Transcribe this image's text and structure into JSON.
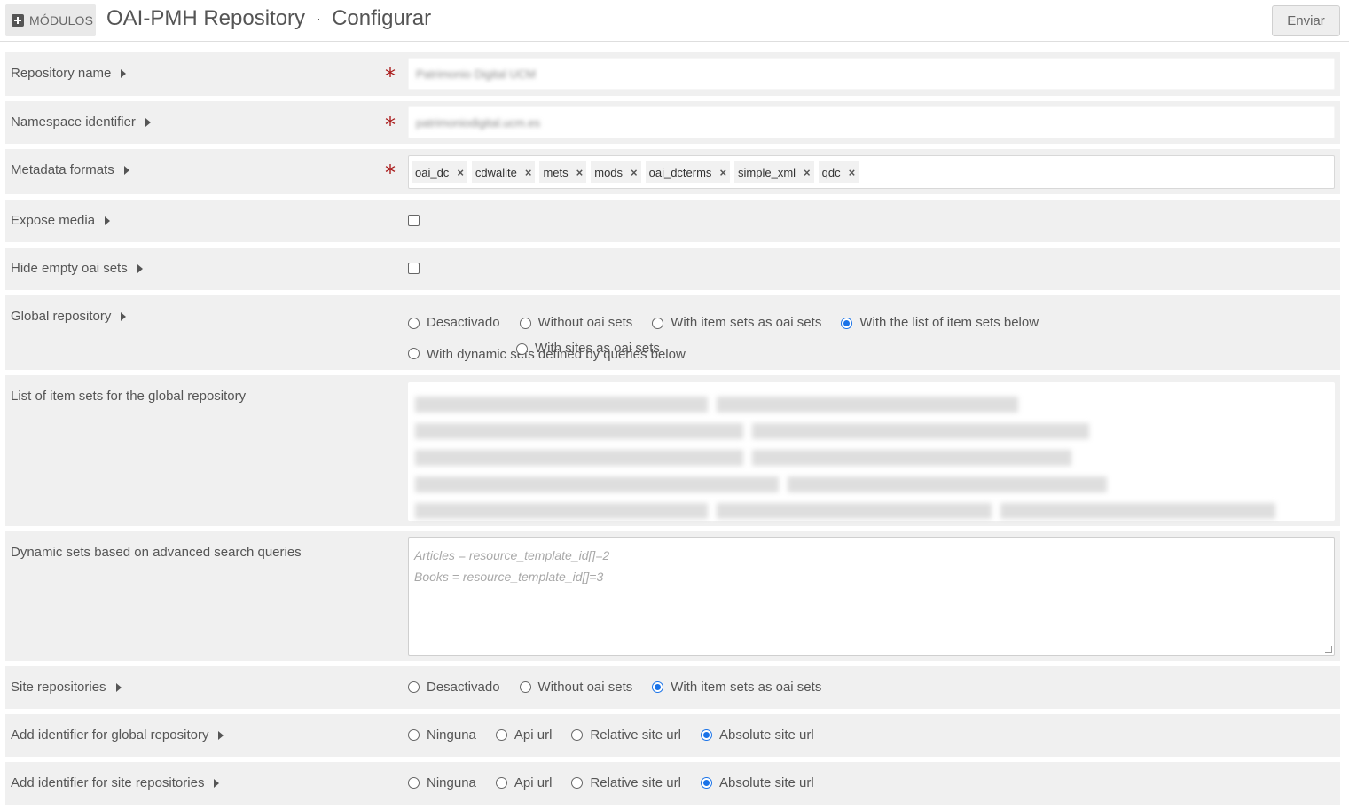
{
  "header": {
    "modules_label": "MÓDULOS",
    "title": "OAI-PMH Repository",
    "separator": "·",
    "subtitle": "Configurar",
    "submit_label": "Enviar"
  },
  "fields": {
    "repository_name": {
      "label": "Repository name",
      "value": "Patrimonio Digital UCM"
    },
    "namespace_identifier": {
      "label": "Namespace identifier",
      "value": "patrimoniodigital.ucm.es"
    },
    "metadata_formats": {
      "label": "Metadata formats",
      "chips": [
        "oai_dc",
        "cdwalite",
        "mets",
        "mods",
        "oai_dcterms",
        "simple_xml",
        "qdc"
      ],
      "remove_symbol": "×"
    },
    "expose_media": {
      "label": "Expose media",
      "checked": false
    },
    "hide_empty_sets": {
      "label": "Hide empty oai sets",
      "checked": false
    },
    "global_repository": {
      "label": "Global repository",
      "options": [
        "Desactivado",
        "Without oai sets",
        "With item sets as oai sets",
        "With the list of item sets below",
        "With dynamic sets defined by queries below",
        "With sites as oai sets"
      ],
      "selected": 3
    },
    "item_sets_list": {
      "label": "List of item sets for the global repository"
    },
    "dynamic_sets": {
      "label": "Dynamic sets based on advanced search queries",
      "placeholder_line1": "Articles = resource_template_id[]=2",
      "placeholder_line2": "Books = resource_template_id[]=3"
    },
    "site_repositories": {
      "label": "Site repositories",
      "options": [
        "Desactivado",
        "Without oai sets",
        "With item sets as oai sets"
      ],
      "selected": 2
    },
    "identifier_global": {
      "label": "Add identifier for global repository",
      "options": [
        "Ninguna",
        "Api url",
        "Relative site url",
        "Absolute site url"
      ],
      "selected": 3
    },
    "identifier_site": {
      "label": "Add identifier for site repositories",
      "options": [
        "Ninguna",
        "Api url",
        "Relative site url",
        "Absolute site url"
      ],
      "selected": 3
    }
  },
  "required_symbol": "*"
}
